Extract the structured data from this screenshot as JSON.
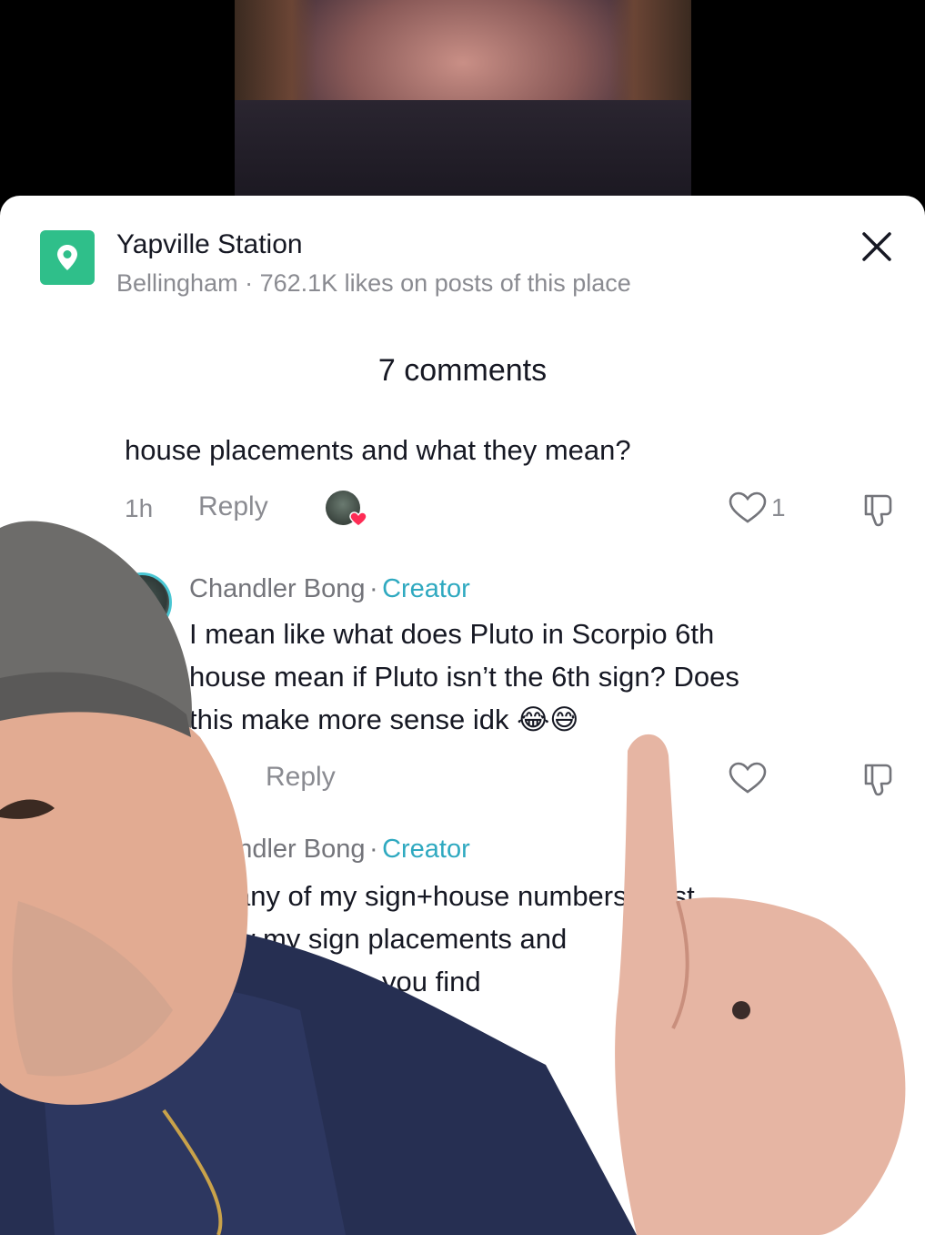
{
  "place": {
    "name": "Yapville Station",
    "subtitle": "Bellingham · 762.1K likes on posts of this place",
    "icon": "location-pin-icon",
    "icon_color": "#2fbf8a"
  },
  "comments_header": "7 comments",
  "comments": [
    {
      "text": "house placements and what they mean?",
      "time": "1h",
      "reply_label": "Reply",
      "likes": "1"
    },
    {
      "author": "Chandler Bong",
      "separator": "·",
      "badge": "Creator",
      "lines": [
        "I mean like what does Pluto in Scorpio 6th",
        "house mean if Pluto isn’t the 6th sign? Does",
        "this make more sense idk 😂😅"
      ],
      "reply_label": "Reply"
    },
    {
      "author": "Chandler Bong",
      "separator": "·",
      "badge": "Creator",
      "lines": [
        "Idk any of my sign+house numbers I just",
        "know my sign placements and",
        "and on how do you find"
      ]
    }
  ],
  "colors": {
    "creator_accent": "#2fa9c0",
    "muted_text": "#8a8b91",
    "primary_text": "#161823"
  }
}
